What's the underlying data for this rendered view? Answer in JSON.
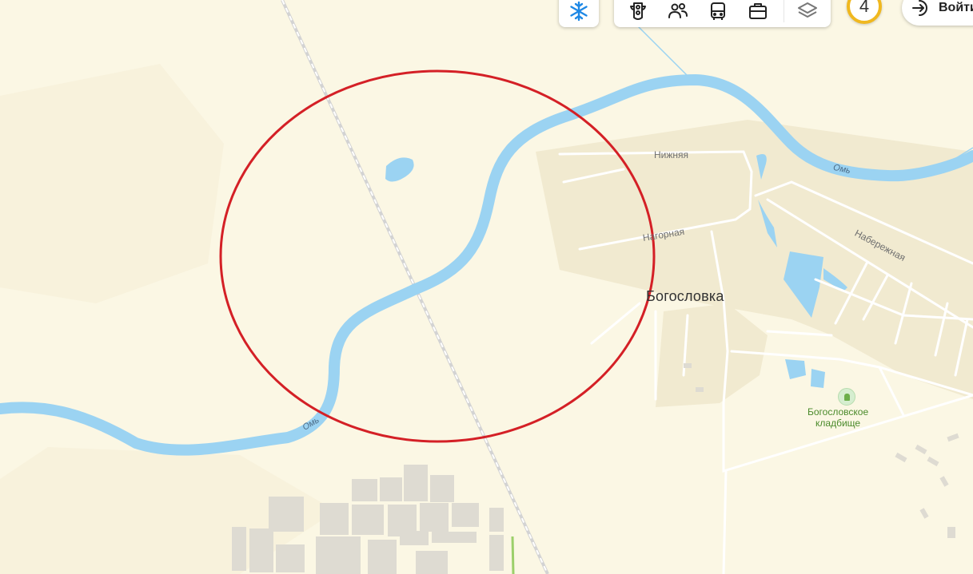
{
  "map": {
    "place_name": "Богословка",
    "river_label": "Омь",
    "streets": {
      "nizhnyaya": "Нижняя",
      "nagornaya": "Нагорная",
      "naberezhnaya": "Набережная"
    },
    "poi": {
      "cemetery_line1": "Богословское",
      "cemetery_line2": "кладбище"
    },
    "colors": {
      "background": "#fbf7e4",
      "water": "#9bd3f2",
      "settlement": "#f1ead0",
      "annotation_circle": "#d42026"
    }
  },
  "toolbar": {
    "icons": [
      "snowflake-icon",
      "traffic-light-icon",
      "people-icon",
      "bus-icon",
      "briefcase-icon",
      "layers-icon"
    ],
    "counter_value": "4",
    "login_label": "Войти"
  }
}
